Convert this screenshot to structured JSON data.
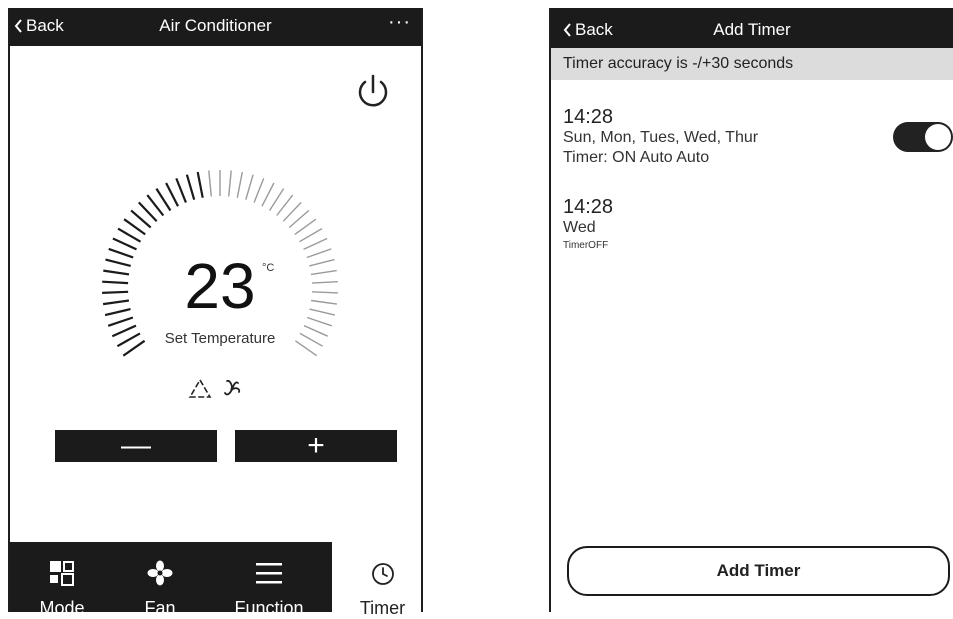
{
  "ac_screen": {
    "back_label": "Back",
    "title": "Air Conditioner",
    "more_label": "···",
    "temperature": "23",
    "unit": "°C",
    "temp_caption": "Set Temperature",
    "decrease_label": "—",
    "increase_label": "+",
    "nav": [
      {
        "label": "Mode",
        "icon": "mode-icon"
      },
      {
        "label": "Fan",
        "icon": "fan-icon"
      },
      {
        "label": "Function",
        "icon": "menu-icon"
      },
      {
        "label": "Timer",
        "icon": "clock-icon"
      }
    ]
  },
  "timer_screen": {
    "back_label": "Back",
    "title": "Add Timer",
    "accuracy_note": "Timer accuracy is -/+30 seconds",
    "timers": [
      {
        "time": "14:28",
        "days": "Sun, Mon, Tues, Wed, Thur",
        "action": "Timer: ON Auto Auto",
        "enabled": true
      },
      {
        "time": "14:28",
        "days": "Wed",
        "action": "TimerOFF"
      }
    ],
    "add_button_label": "Add Timer"
  },
  "colors": {
    "dark": "#1b1b1b",
    "banner": "#dcdcdc",
    "background": "#ffffff"
  }
}
